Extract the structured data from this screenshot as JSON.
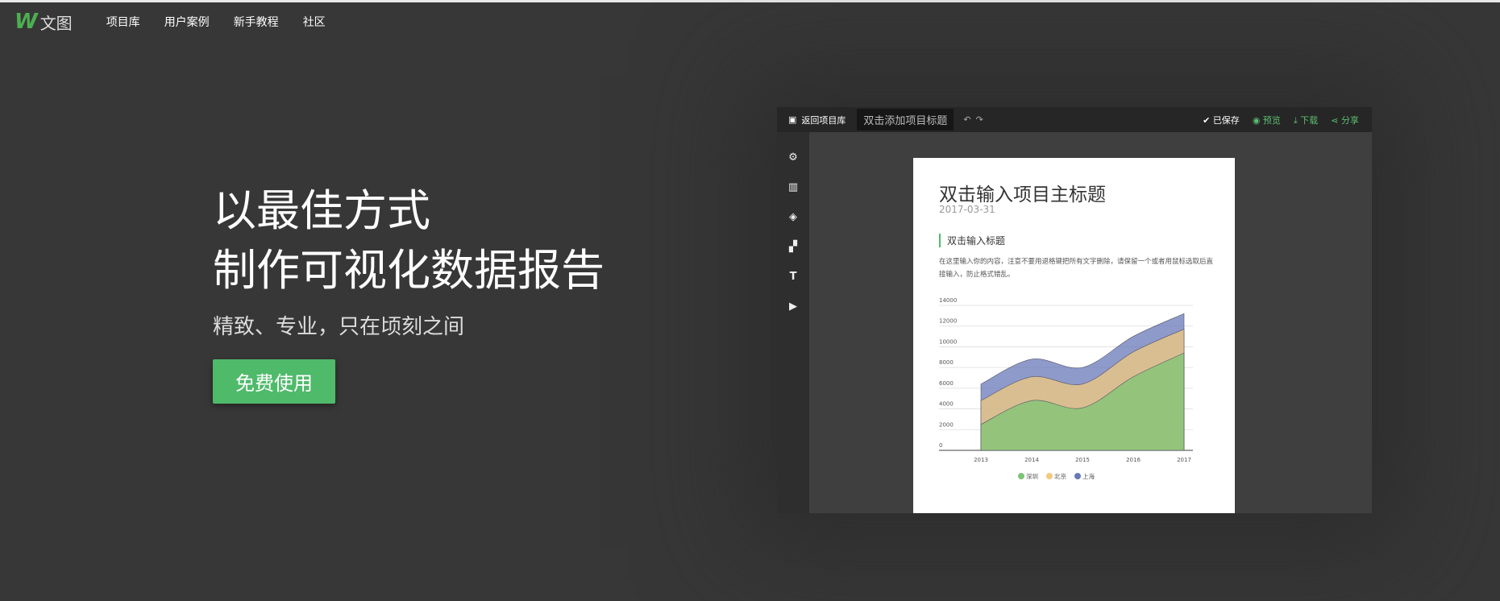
{
  "nav": {
    "logo_text": "文图",
    "items": [
      "项目库",
      "用户案例",
      "新手教程",
      "社区"
    ]
  },
  "hero": {
    "line1": "以最佳方式",
    "line2": "制作可视化数据报告",
    "subtitle": "精致、专业，只在顷刻之间",
    "cta": "免费使用"
  },
  "editor": {
    "back": "返回项目库",
    "title_placeholder": "双击添加项目标题",
    "saved": "已保存",
    "preview": "预览",
    "download": "下载",
    "share": "分享",
    "page": {
      "title": "双击输入项目主标题",
      "date": "2017-03-31",
      "section": "双击输入标题",
      "paragraph": "在这里输入你的内容，注意不要用退格键把所有文字删除，请保留一个或者用鼠标选取后直接输入，防止格式错乱。"
    }
  },
  "chart_data": {
    "type": "area",
    "stacked": true,
    "categories": [
      "2013",
      "2014",
      "2015",
      "2016",
      "2017"
    ],
    "ylim": [
      0,
      14000
    ],
    "yticks": [
      "0",
      "2000",
      "4000",
      "6000",
      "8000",
      "10000",
      "12000",
      "14000"
    ],
    "series": [
      {
        "name": "深圳",
        "color": "#7cc576",
        "values": [
          2500,
          4800,
          4100,
          7100,
          9400
        ]
      },
      {
        "name": "北京",
        "color": "#f2c97d",
        "values": [
          2300,
          2300,
          2300,
          2400,
          2300
        ]
      },
      {
        "name": "上海",
        "color": "#6878b8",
        "values": [
          1600,
          1700,
          1600,
          1500,
          1500
        ]
      }
    ],
    "legend": "bottom"
  }
}
